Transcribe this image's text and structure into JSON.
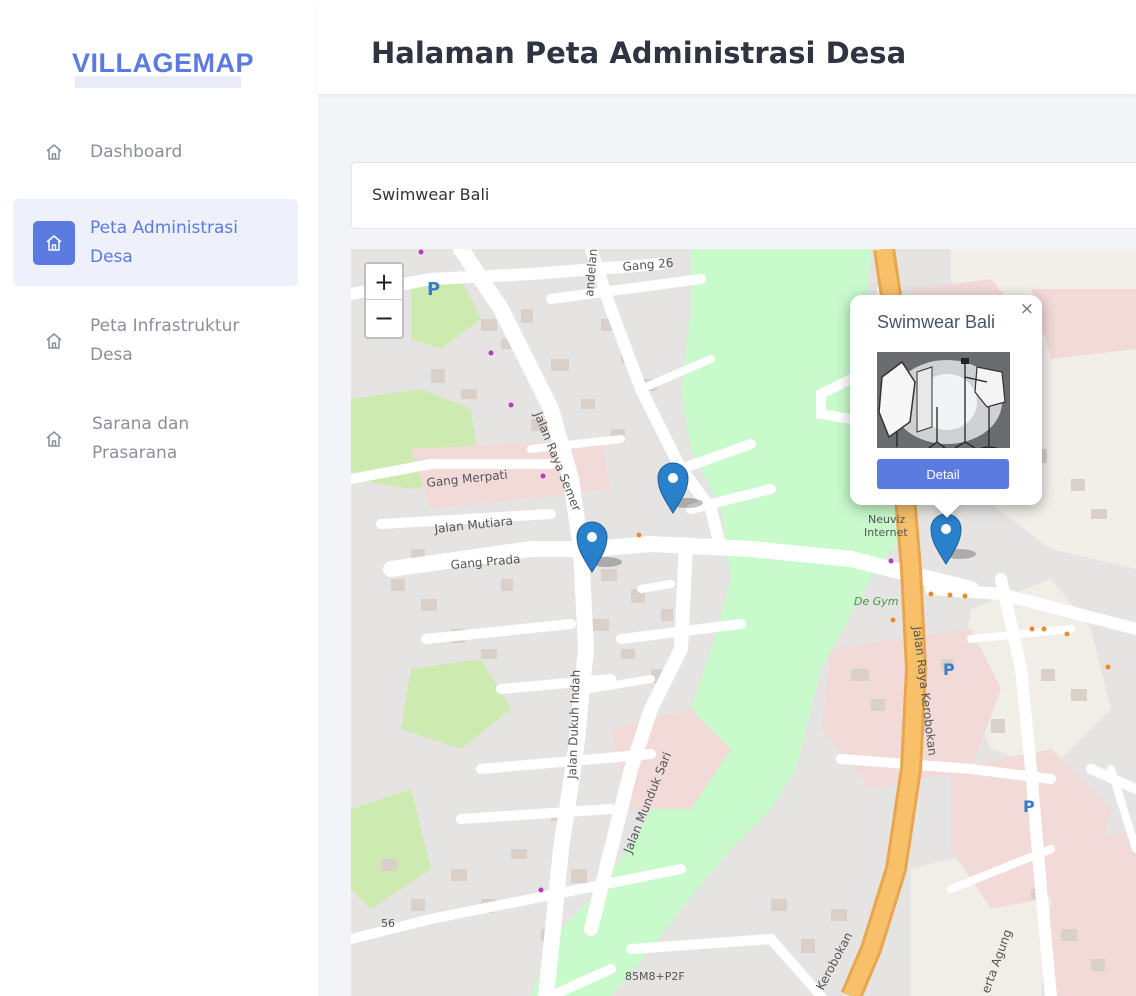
{
  "app": {
    "brand": "VILLAGEMAP"
  },
  "sidebar": {
    "items": [
      {
        "label": "Dashboard",
        "icon": "home-icon",
        "active": false
      },
      {
        "label": "Peta Administrasi Desa",
        "icon": "home-icon",
        "active": true
      },
      {
        "label": "Peta Infrastruktur Desa",
        "icon": "home-icon",
        "active": false
      },
      {
        "label": "Sarana dan Prasarana",
        "icon": "home-icon",
        "active": false
      }
    ]
  },
  "header": {
    "title": "Halaman Peta Administrasi Desa"
  },
  "search": {
    "value": "Swimwear Bali",
    "placeholder": ""
  },
  "map": {
    "zoom_in": "+",
    "zoom_out": "−",
    "labels": {
      "gang_26": "Gang 26",
      "kandelan": "andelan",
      "gang_merpati": "Gang Merpati",
      "jalan_mutiara": "Jalan Mutiara",
      "gang_prada": "Gang Prada",
      "jalan_raya_semer": "Jalan Raya Semer",
      "jalan_dukuh_indah": "Jalan Dukuh Indah",
      "jalan_munduk_sari": "Jalan Munduk Sari",
      "jalan_raya_kerobokan": "Jalan Raya Kerobokan",
      "neuviz": "Neuviz",
      "internet": "Internet",
      "de_gym": "De Gym",
      "kerobokan": "Kerobokan",
      "perta_agung": "erta Agung",
      "plus_code": "85M8+P2F",
      "road_56": "56"
    },
    "popup": {
      "title": "Swimwear Bali",
      "close": "×",
      "button": "Detail"
    },
    "colors": {
      "marker": "#2a81cb",
      "green": "#c8facc",
      "residential": "#e0dfdf",
      "main_road": "#f7c069"
    }
  }
}
